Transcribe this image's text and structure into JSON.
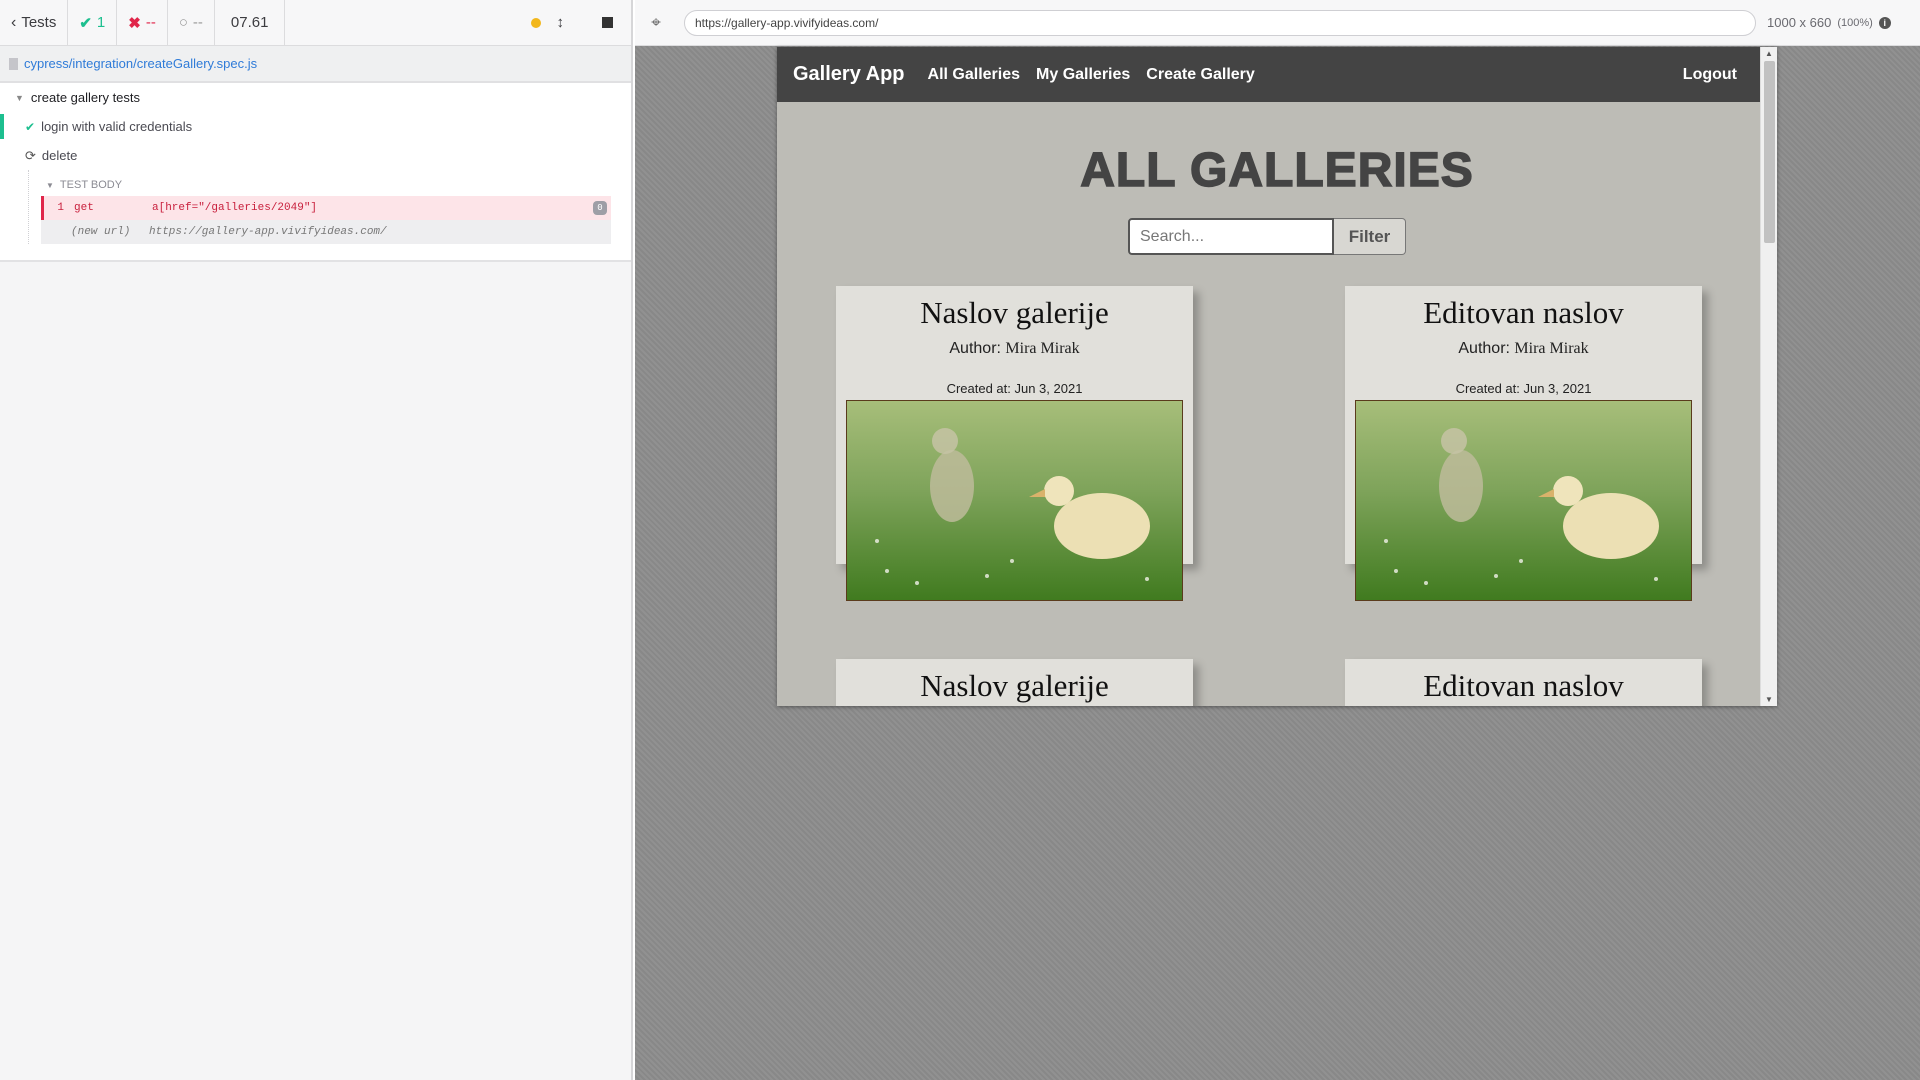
{
  "runner": {
    "back_label": "Tests",
    "passed": "1",
    "failed": "--",
    "pending": "--",
    "duration": "07.61",
    "spec_path": "cypress/integration/createGallery.spec.js",
    "suite_title": "create gallery tests",
    "tests": [
      {
        "title": "login with valid credentials",
        "state": "passed"
      },
      {
        "title": "delete",
        "state": "running"
      }
    ],
    "test_body_label": "TEST BODY",
    "commands": [
      {
        "num": "1",
        "name": "get",
        "message": "a[href=\"/galleries/2049\"]",
        "badge": "0"
      },
      {
        "num": "",
        "name": "(new url)",
        "message": "https://gallery-app.vivifyideas.com/"
      }
    ]
  },
  "browser": {
    "url": "https://gallery-app.vivifyideas.com/",
    "size": "1000 x 660",
    "zoom": "(100%)"
  },
  "app": {
    "brand": "Gallery App",
    "nav": [
      "All Galleries",
      "My Galleries",
      "Create Gallery"
    ],
    "logout": "Logout",
    "heading": "ALL GALLERIES",
    "search_placeholder": "Search...",
    "filter_label": "Filter",
    "author_label": "Author:",
    "galleries": [
      {
        "title": "Naslov galerije",
        "author": "Mira Mirak",
        "created": "Created at: Jun 3, 2021"
      },
      {
        "title": "Editovan naslov",
        "author": "Mira Mirak",
        "created": "Created at: Jun 3, 2021"
      },
      {
        "title": "Naslov galerije",
        "author": "",
        "created": ""
      },
      {
        "title": "Editovan naslov",
        "author": "",
        "created": ""
      }
    ]
  },
  "colors": {
    "pass": "#1dbf8f",
    "fail": "#e0264a",
    "nav_bg": "#444444",
    "page_bg": "#bdbcb6"
  }
}
